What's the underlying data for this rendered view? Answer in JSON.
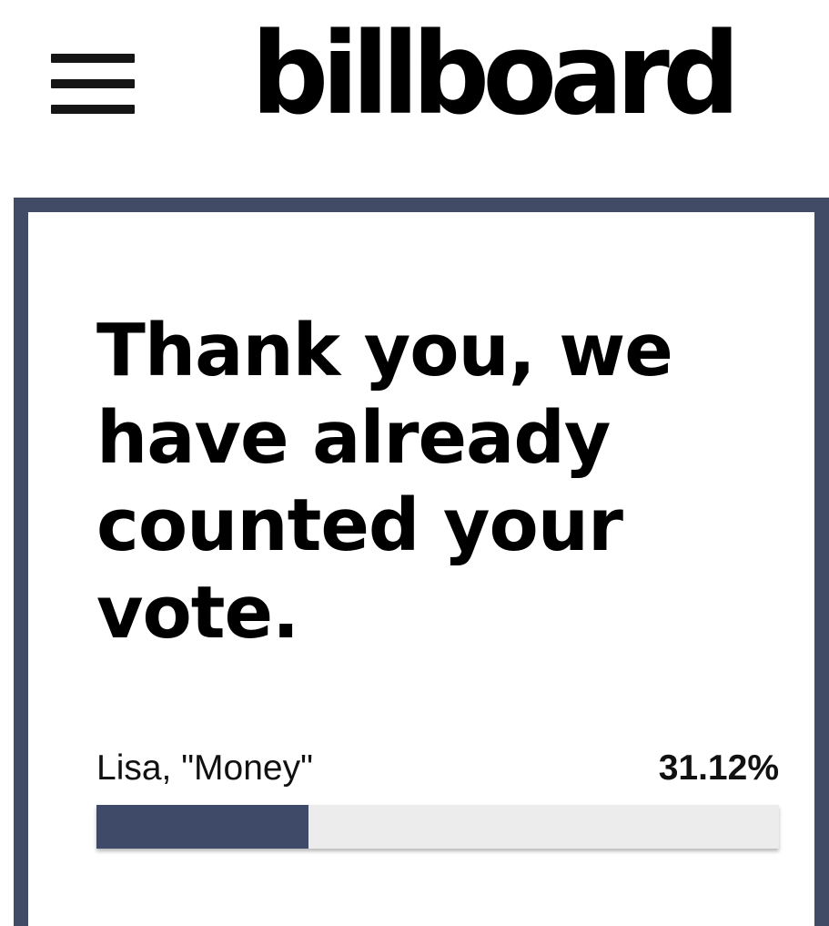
{
  "header": {
    "menu_icon": "hamburger-menu-icon",
    "logo_text": "billboard"
  },
  "poll": {
    "headline": "Thank you, we have already counted your vote.",
    "results": [
      {
        "label": "Lisa, \"Money\"",
        "percent_text": "31.12%",
        "percent_value": 31.12
      }
    ]
  },
  "colors": {
    "accent": "#414b66",
    "progress_fill": "#3f4a68",
    "progress_track": "#ececec",
    "text": "#000000",
    "background": "#ffffff"
  }
}
